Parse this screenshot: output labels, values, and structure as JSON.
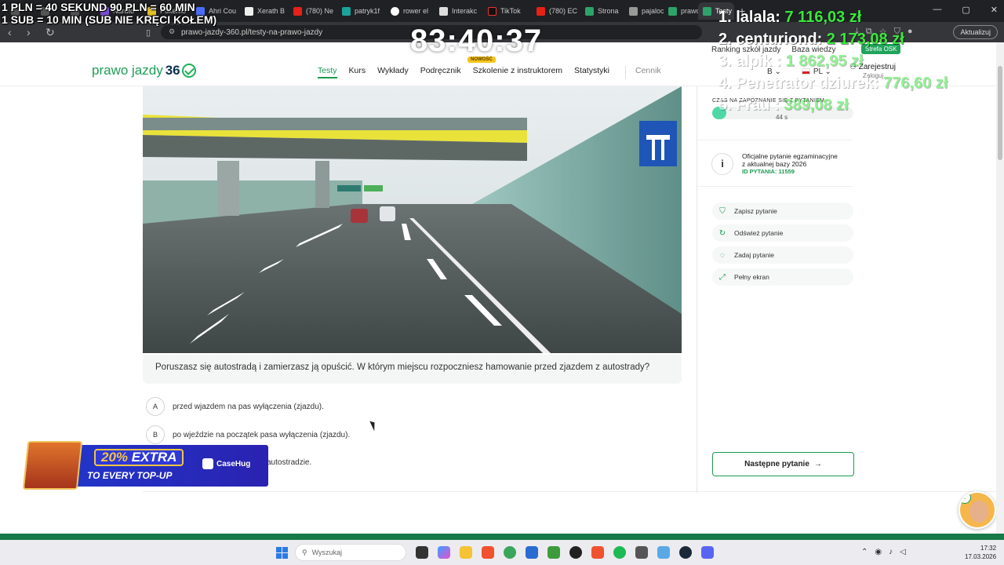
{
  "stream_overlay": {
    "line1": "1 PLN =  40 SEKUND 90 PLN = 60 MIN",
    "line2": "1 SUB = 10 MIN (SUB NIE KRĘCI KOŁEM)",
    "timer": "83:40:37",
    "ranking": [
      {
        "name": "1. lalala:",
        "amount": "7 116,03 zł"
      },
      {
        "name": "2. centuriond:",
        "amount": "2 173,08 zł"
      },
      {
        "name": "3. alpik :",
        "amount": "1 862,95 zł"
      },
      {
        "name": "4. Penetrator dziurek:",
        "amount": "776,60 zł"
      },
      {
        "name": "5. Frau :",
        "amount": "389,08 zł"
      }
    ]
  },
  "browser": {
    "tabs": [
      "Naruto",
      "Pokémo",
      "Ahri Cou",
      "Xerath B",
      "(780) Ne",
      "patryk1f",
      "rower el",
      "Interakc",
      "TikTok",
      "(780) EC",
      "Strona",
      "pajaloc",
      "prawo",
      "Testy"
    ],
    "url": "prawo-jazdy-360.pl/testy-na-prawo-jazdy",
    "update_label": "Aktualizuj"
  },
  "site": {
    "logo_text": "prawo jazdy",
    "logo_num": "36",
    "nav": [
      "Testy",
      "Kurs",
      "Wykłady",
      "Podręcznik",
      "Szkolenie z instruktorem",
      "Statystyki",
      "Cennik"
    ],
    "new_badge": "NOWOŚĆ",
    "top_links": [
      "Ranking szkół jazdy",
      "Baza wiedzy"
    ],
    "strefa": "Strefa OSK",
    "category": "B",
    "language": "PL",
    "register": "Zarejestruj",
    "login": "Zaloguj"
  },
  "question": {
    "text": "Poruszasz się autostradą i zamierzasz ją opuścić. W którym miejscu rozpoczniesz hamowanie przed zjazdem z autostrady?",
    "answers": [
      {
        "key": "A",
        "text": "przed wjazdem na pas wyłączenia (zjazdu)."
      },
      {
        "key": "B",
        "text": "po wjeździe na początek pasa wyłączenia (zjazdu)."
      },
      {
        "key": "C",
        "text": "autostradzie."
      }
    ]
  },
  "sidebar": {
    "time_label": "CZAS NA ZAPOZNANIE SIĘ Z PYTANIEM",
    "time_fraction": 0.1,
    "seconds": "44 s",
    "info_line1": "Oficjalne pytanie egzaminacyjne",
    "info_line2": "z aktualnej bazy 2026",
    "question_id": "ID PYTANIA: 11559",
    "actions": [
      "Zapisz pytanie",
      "Odśwież pytanie",
      "Zadaj pytanie",
      "Pełny ekran"
    ],
    "next": "Następne pytanie"
  },
  "promo": {
    "percent": "20%",
    "extra": "EXTRA",
    "sub": "TO EVERY TOP-UP",
    "brand": "CaseHug"
  },
  "taskbar": {
    "search": "Wyszukaj",
    "time": "17:32",
    "date": "17.03.2026"
  }
}
